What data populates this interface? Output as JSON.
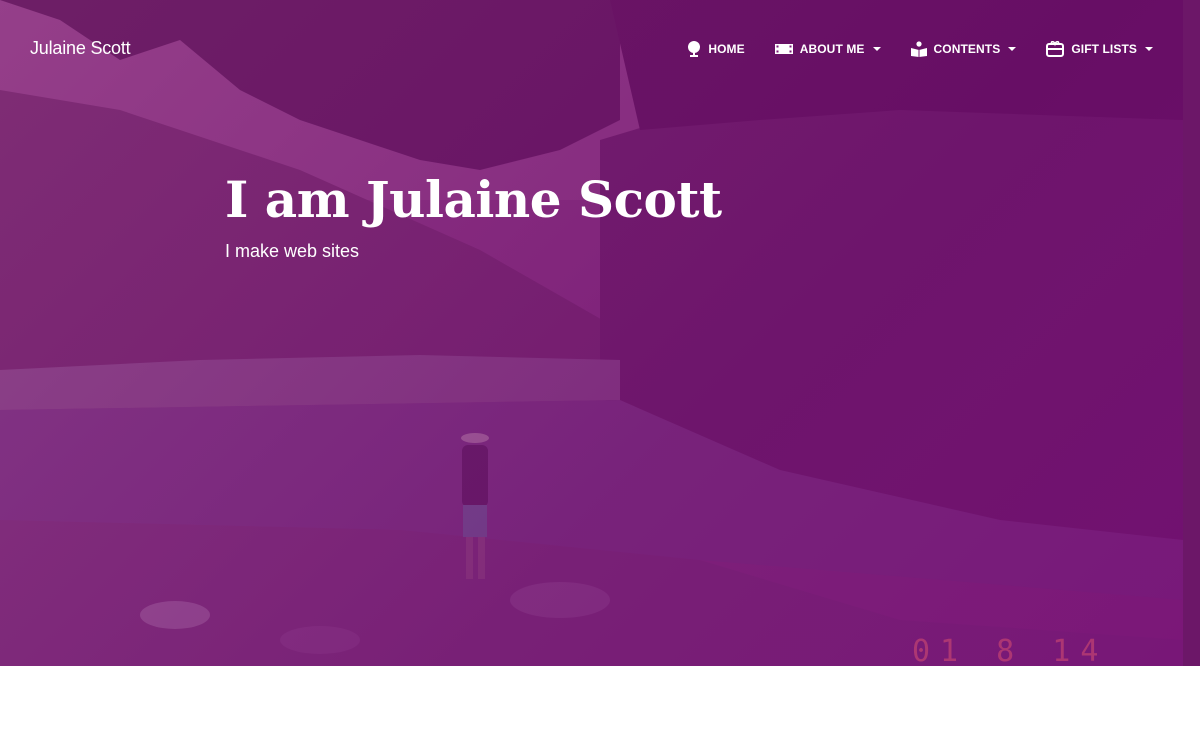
{
  "brand": {
    "title": "Julaine Scott"
  },
  "nav": {
    "items": [
      {
        "label": "HOME",
        "icon": "tree-icon",
        "dropdown": false
      },
      {
        "label": "ABOUT ME",
        "icon": "film-icon",
        "dropdown": true
      },
      {
        "label": "CONTENTS",
        "icon": "reader-icon",
        "dropdown": true
      },
      {
        "label": "GIFT LISTS",
        "icon": "gift-card-icon",
        "dropdown": true
      }
    ]
  },
  "hero": {
    "title": "I am Julaine Scott",
    "subtitle": "I make web sites",
    "photo_date_stamp": "01 8 14"
  },
  "colors": {
    "overlay": "#7a1a76",
    "text": "#ffffff"
  }
}
